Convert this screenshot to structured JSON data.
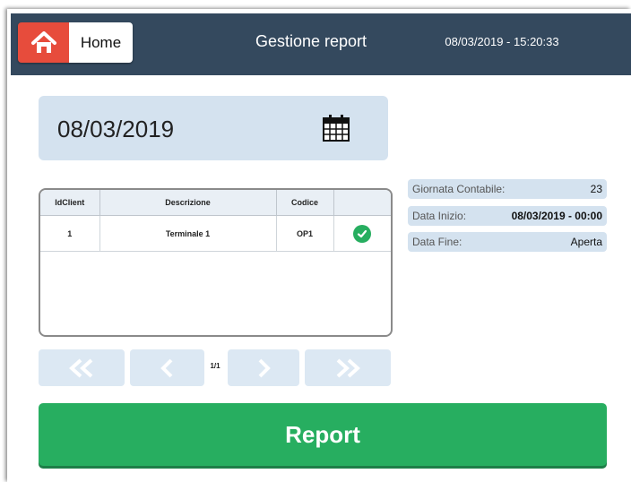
{
  "header": {
    "home_label": "Home",
    "title": "Gestione report",
    "datetime": "08/03/2019 - 15:20:33"
  },
  "date_picker": {
    "value": "08/03/2019",
    "icon": "calendar-icon"
  },
  "grid": {
    "columns": [
      "IdClient",
      "Descrizione",
      "Codice",
      ""
    ],
    "rows": [
      {
        "idclient": "1",
        "descrizione": "Terminale 1",
        "codice": "OP1",
        "status": "check-icon"
      }
    ]
  },
  "info": {
    "giornata_label": "Giornata Contabile:",
    "giornata_value": "23",
    "inizio_label": "Data Inizio:",
    "inizio_value": "08/03/2019 - 00:00",
    "fine_label": "Data Fine:",
    "fine_value": "Aperta"
  },
  "pager": {
    "indicator": "1/1"
  },
  "actions": {
    "report_label": "Report"
  },
  "colors": {
    "header_bg": "#34495e",
    "home_red": "#e74c3c",
    "panel_blue": "#d4e2ef",
    "success_green": "#27ae60"
  }
}
